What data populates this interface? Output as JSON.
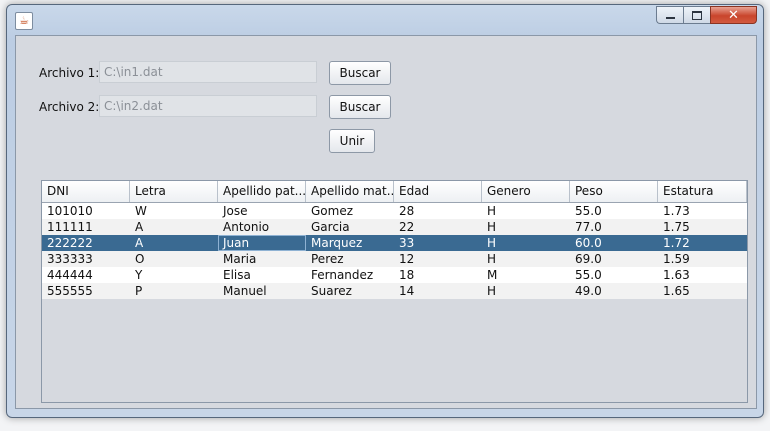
{
  "form": {
    "file1_label": "Archivo 1:",
    "file1_value": "C:\\in1.dat",
    "file2_label": "Archivo 2:",
    "file2_value": "C:\\in2.dat",
    "browse1_label": "Buscar",
    "browse2_label": "Buscar",
    "merge_label": "Unir"
  },
  "table": {
    "columns": [
      "DNI",
      "Letra",
      "Apellido pat...",
      "Apellido mat...",
      "Edad",
      "Genero",
      "Peso",
      "Estatura"
    ],
    "rows": [
      [
        "101010",
        "W",
        "Jose",
        "Gomez",
        "28",
        "H",
        "55.0",
        "1.73"
      ],
      [
        "111111",
        "A",
        "Antonio",
        "Garcia",
        "22",
        "H",
        "77.0",
        "1.75"
      ],
      [
        "222222",
        "A",
        "Juan",
        "Marquez",
        "33",
        "H",
        "60.0",
        "1.72"
      ],
      [
        "333333",
        "O",
        "Maria",
        "Perez",
        "12",
        "H",
        "69.0",
        "1.59"
      ],
      [
        "444444",
        "Y",
        "Elisa",
        "Fernandez",
        "18",
        "M",
        "55.0",
        "1.63"
      ],
      [
        "555555",
        "P",
        "Manuel",
        "Suarez",
        "14",
        "H",
        "49.0",
        "1.65"
      ]
    ],
    "selected_row_index": 2
  },
  "colors": {
    "selection": "#3a6a92",
    "close_button": "#c9452c"
  },
  "icons": {
    "app": "java-icon",
    "minimize": "minimize-icon",
    "maximize": "maximize-icon",
    "close": "close-icon"
  }
}
